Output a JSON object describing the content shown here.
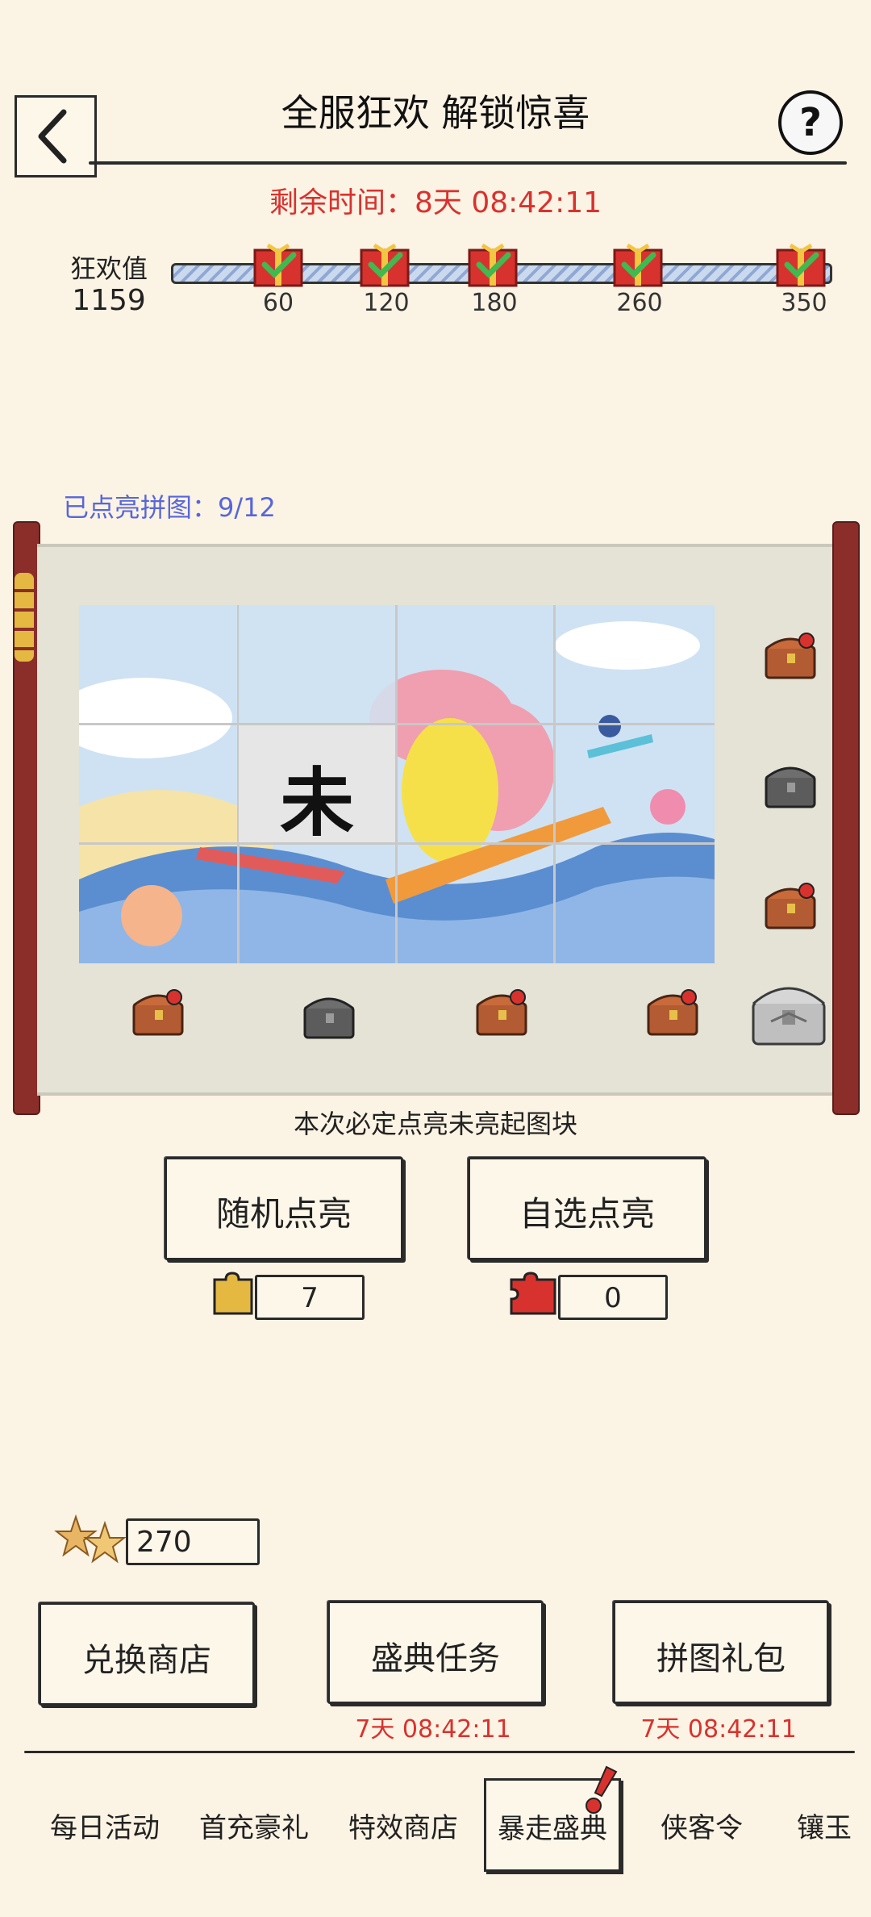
{
  "header": {
    "title": "全服狂欢 解锁惊喜",
    "back_icon": "back-arrow-icon",
    "help_icon": "question-mark-icon"
  },
  "timer": {
    "label": "剩余时间：8天 08:42:11"
  },
  "progress": {
    "label": "狂欢值",
    "value": "1159",
    "milestones": [
      "60",
      "120",
      "180",
      "260",
      "350"
    ]
  },
  "puzzle": {
    "count_label": "已点亮拼图：9/12",
    "locked_tile_text": "未",
    "hint": "本次必定点亮未亮起图块"
  },
  "actions": {
    "random_label": "随机点亮",
    "random_count": "7",
    "select_label": "自选点亮",
    "select_count": "0"
  },
  "currency": {
    "amount": "270"
  },
  "shop_buttons": {
    "exchange": "兑换商店",
    "tasks": "盛典任务",
    "tasks_timer": "7天 08:42:11",
    "gift_pack": "拼图礼包",
    "gift_pack_timer": "7天 08:42:11"
  },
  "tabs": [
    "每日活动",
    "首充豪礼",
    "特效商店",
    "暴走盛典",
    "侠客令",
    "镶玉"
  ],
  "colors": {
    "accent_red": "#d8322e",
    "link_blue": "#5866d8",
    "scroll_red": "#8b2e2a"
  }
}
